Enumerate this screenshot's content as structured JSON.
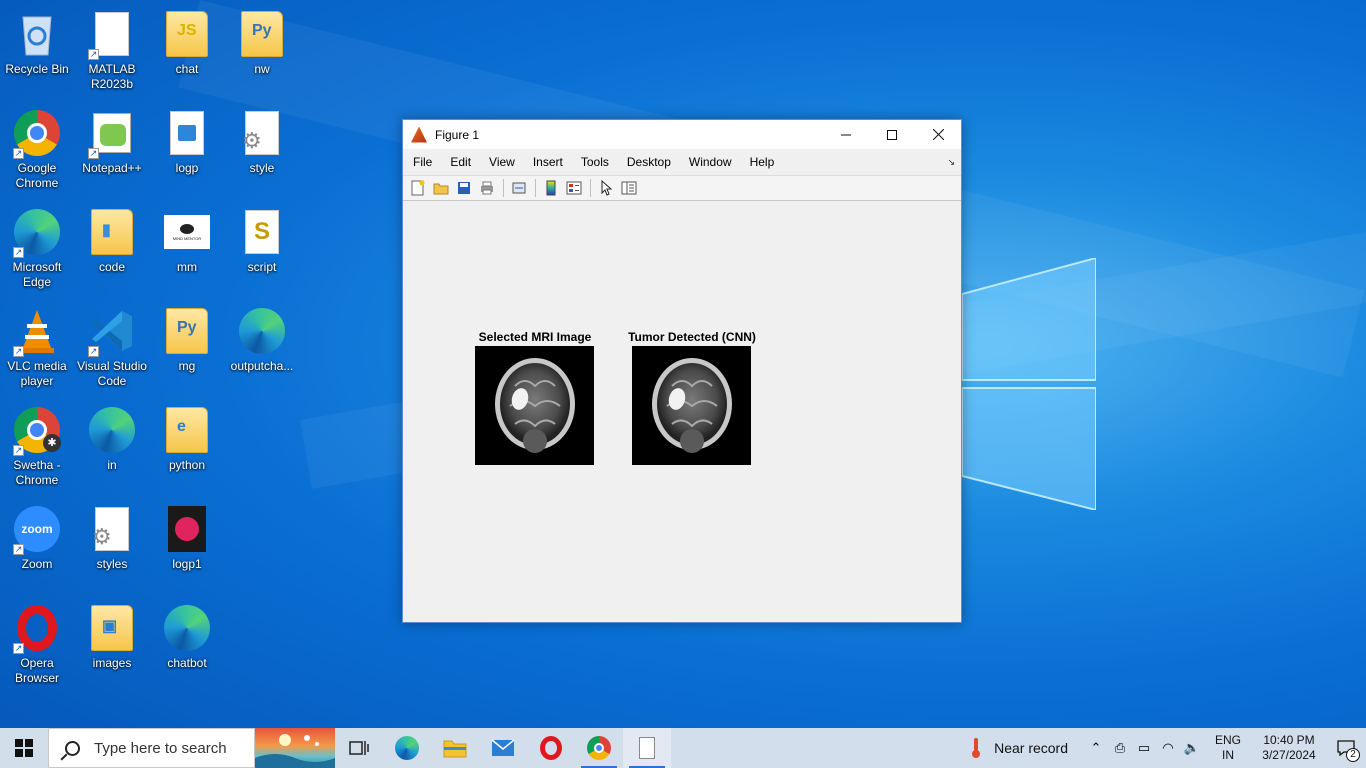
{
  "desktop": {
    "icons": [
      {
        "label": "Recycle Bin"
      },
      {
        "label": "MATLAB R2023b"
      },
      {
        "label": "chat"
      },
      {
        "label": "nw"
      },
      {
        "label": "Google Chrome"
      },
      {
        "label": "Notepad++"
      },
      {
        "label": "logp"
      },
      {
        "label": "style"
      },
      {
        "label": "Microsoft Edge"
      },
      {
        "label": "code"
      },
      {
        "label": "mm"
      },
      {
        "label": "script"
      },
      {
        "label": "VLC media player"
      },
      {
        "label": "Visual Studio Code"
      },
      {
        "label": "mg"
      },
      {
        "label": "outputcha..."
      },
      {
        "label": "Swetha - Chrome"
      },
      {
        "label": "in"
      },
      {
        "label": "python"
      },
      {
        "label": "Zoom"
      },
      {
        "label": "styles"
      },
      {
        "label": "logp1"
      },
      {
        "label": "Opera Browser"
      },
      {
        "label": "images"
      },
      {
        "label": "chatbot"
      }
    ],
    "mm_icon_text": "MIND MENTOR",
    "zoom_icon_text": "zoom"
  },
  "figure": {
    "title": "Figure 1",
    "menu": [
      "File",
      "Edit",
      "View",
      "Insert",
      "Tools",
      "Desktop",
      "Window",
      "Help"
    ],
    "axes": [
      {
        "title": "Selected MRI Image"
      },
      {
        "title": "Tumor Detected (CNN)"
      }
    ]
  },
  "taskbar": {
    "search_placeholder": "Type here to search",
    "weather_text": "Near record",
    "language_line1": "ENG",
    "language_line2": "IN",
    "time": "10:40 PM",
    "date": "3/27/2024",
    "notification_count": "2"
  },
  "colors": {
    "desktop_blue": "#0a6fd4",
    "taskbar": "#dae2ec",
    "window_border": "#5b8fd4"
  }
}
